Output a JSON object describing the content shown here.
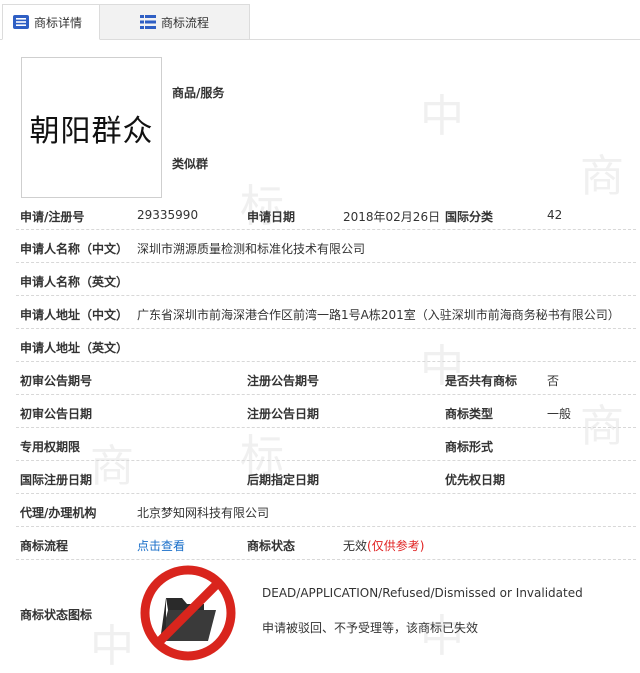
{
  "tabs": [
    {
      "label": "商标详情",
      "active": true
    },
    {
      "label": "商标流程",
      "active": false
    }
  ],
  "logo": {
    "text": "朝阳群众"
  },
  "side_labels": {
    "goods": "商品/服务",
    "similar": "类似群"
  },
  "rows": {
    "reg_no_label": "申请/注册号",
    "reg_no": "29335990",
    "app_date_label": "申请日期",
    "app_date": "2018年02月26日",
    "intl_class_label": "国际分类",
    "intl_class": "42",
    "applicant_cn_label": "申请人名称（中文）",
    "applicant_cn": "深圳市溯源质量检测和标准化技术有限公司",
    "applicant_en_label": "申请人名称（英文）",
    "address_cn_label": "申请人地址（中文）",
    "address_cn": "广东省深圳市前海深港合作区前湾一路1号A栋201室（入驻深圳市前海商务秘书有限公司）",
    "address_en_label": "申请人地址（英文）",
    "prelim_pub_no_label": "初审公告期号",
    "reg_pub_no_label": "注册公告期号",
    "shared_label": "是否共有商标",
    "shared": "否",
    "prelim_pub_date_label": "初审公告日期",
    "reg_pub_date_label": "注册公告日期",
    "mark_type_label": "商标类型",
    "mark_type": "一般",
    "exclusive_period_label": "专用权期限",
    "mark_form_label": "商标形式",
    "intl_reg_date_label": "国际注册日期",
    "later_designation_label": "后期指定日期",
    "priority_date_label": "优先权日期",
    "agent_label": "代理/办理机构",
    "agent": "北京梦知网科技有限公司",
    "flow_label": "商标流程",
    "flow_link": "点击查看",
    "status_label": "商标状态",
    "status": "无效",
    "status_note": "(仅供参考)",
    "status_icon_label": "商标状态图标"
  },
  "status_desc": {
    "en": "DEAD/APPLICATION/Refused/Dismissed or Invalidated",
    "cn": "申请被驳回、不予受理等，该商标已失效"
  },
  "colors": {
    "accent": "#1a6fc9",
    "dead": "#d9251d",
    "tab_icon": "#2f5fc4"
  }
}
